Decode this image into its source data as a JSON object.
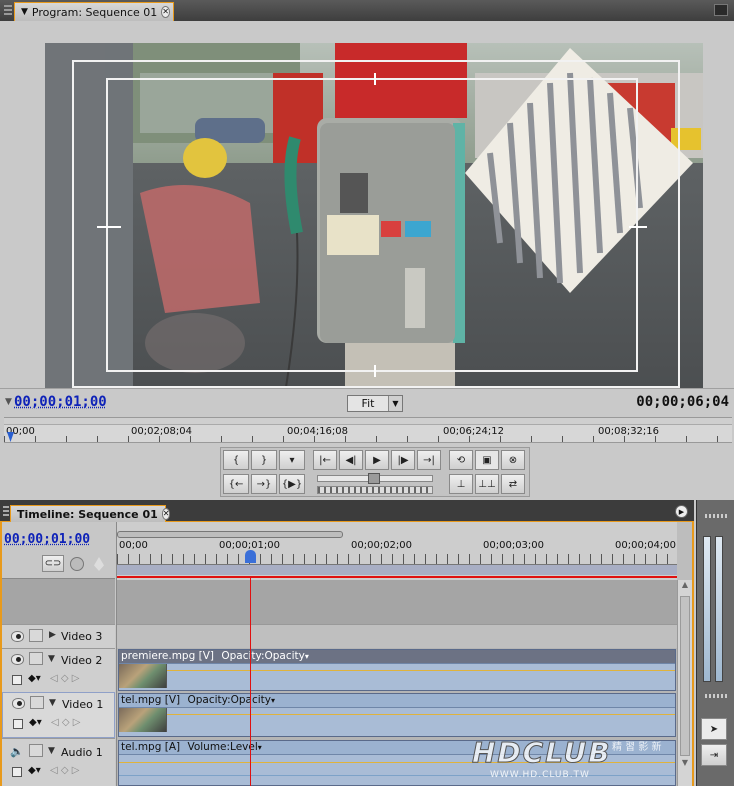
{
  "program_monitor": {
    "tab_label": "Program: Sequence 01",
    "current_timecode": "00;00;01;00",
    "duration_timecode": "00;00;06;04",
    "zoom_value": "Fit",
    "ruler_ticks": [
      "00;00",
      "00;02;08;04",
      "00;04;16;08",
      "00;06;24;12",
      "00;08;32;16"
    ]
  },
  "timeline": {
    "tab_label": "Timeline: Sequence 01",
    "current_timecode": "00;00;01;00",
    "ruler_ticks": [
      "00;00",
      "00;00;01;00",
      "00;00;02;00",
      "00;00;03;00",
      "00;00;04;00"
    ],
    "tracks": [
      {
        "name": "Video 3"
      },
      {
        "name": "Video 2",
        "clip_name": "premiere.mpg [V]",
        "effect": "Opacity:Opacity"
      },
      {
        "name": "Video 1",
        "clip_name": "tel.mpg [V]",
        "effect": "Opacity:Opacity"
      },
      {
        "name": "Audio 1",
        "clip_name": "tel.mpg [A]",
        "effect": "Volume:Level"
      }
    ]
  },
  "watermark": {
    "logo": "HDCLUB",
    "chinese": "精 習 影 新",
    "url": "WWW.HD.CLUB.TW"
  },
  "colors": {
    "accent_orange": "#e89a1c",
    "timecode_blue": "#0e22b8",
    "playhead_red": "#e01010",
    "clip_blue": "#a9bcd6"
  }
}
